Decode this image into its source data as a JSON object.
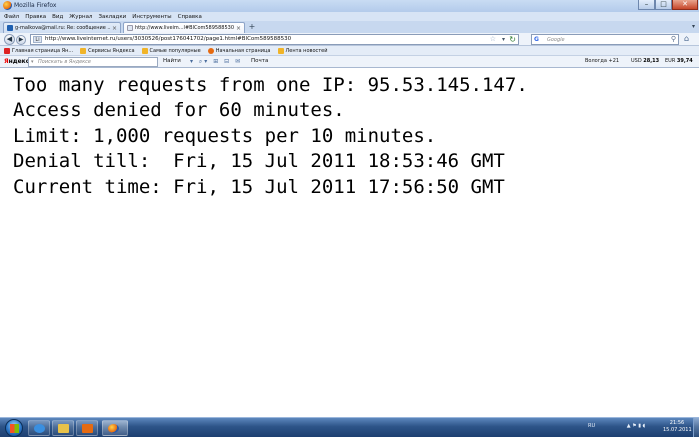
{
  "window": {
    "title": "Mozilla Firefox",
    "buttons": {
      "minimize": "–",
      "maximize": "□",
      "close": "✕"
    }
  },
  "menu": [
    "Файл",
    "Правка",
    "Вид",
    "Журнал",
    "Закладки",
    "Инструменты",
    "Справка"
  ],
  "tabs": [
    {
      "label": "g-malkova@mail.ru: Re: сообщение ...",
      "active": false,
      "close": "×"
    },
    {
      "label": "http://www.liveim...l#BlCom589588530",
      "active": true,
      "close": "×"
    }
  ],
  "tab_controls": {
    "new_tab": "+",
    "list_tabs": "▾"
  },
  "nav": {
    "back": "◀",
    "forward": "▶",
    "site_icon": "Li",
    "url": "http://www.liveinternet.ru/users/3030526/post176041702/page1.html#BlCom589588530",
    "star": "☆",
    "dropdown": "▾",
    "reload": "↻",
    "search_engine": "G",
    "search_placeholder": "Google",
    "search_go": "⚲",
    "home": "⌂"
  },
  "bookmarks": [
    {
      "label": "Главная страница Ян...",
      "color": "#d22"
    },
    {
      "label": "Сервисы Яндекса",
      "color": "#f0b429"
    },
    {
      "label": "Самые популярные",
      "color": "#f0b429"
    },
    {
      "label": "Начальная страница",
      "color": "#e56a11"
    },
    {
      "label": "Лента новостей",
      "color": "#f0b429"
    }
  ],
  "yandex_bar": {
    "logo_first": "Я",
    "logo_rest": "ндекс",
    "search_icon": "▾",
    "search_placeholder": "Поискать в Яндексе",
    "find_label": "Найти",
    "toolbar_icons": "▾ ⌕▾ ⊞ ⊟ ✉",
    "mail_label": "Почта",
    "weather": {
      "city": "Вологда",
      "temp": "+21"
    },
    "rates": [
      {
        "label": "USD",
        "value": "28,13"
      },
      {
        "label": "EUR",
        "value": "39,74"
      }
    ]
  },
  "content": {
    "lines": [
      "Too many requests from one IP: 95.53.145.147.",
      "Access denied for 60 minutes.",
      "Limit: 1,000 requests per 10 minutes.",
      "Denial till:  Fri, 15 Jul 2011 18:53:46 GMT",
      "Current time: Fri, 15 Jul 2011 17:56:50 GMT"
    ]
  },
  "taskbar": {
    "tray_lang": "RU",
    "tray_icons": "▲ ⚑ ▮ ◖",
    "time": "21:56",
    "date": "15.07.2011"
  }
}
